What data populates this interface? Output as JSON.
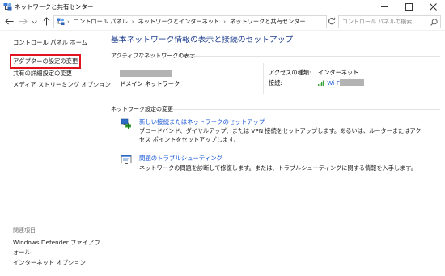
{
  "window": {
    "title": "ネットワークと共有センター",
    "controls": {
      "minimize": "minimize-icon",
      "maximize": "maximize-icon",
      "close": "close-icon"
    }
  },
  "address_bar": {
    "breadcrumbs": [
      "コントロール パネル",
      "ネットワークとインターネット",
      "ネットワークと共有センター"
    ],
    "separator": "›",
    "search_placeholder": "コントロール パネルの検索"
  },
  "sidebar": {
    "links": [
      {
        "label": "コントロール パネル ホーム",
        "highlighted": false
      },
      {
        "label": "アダプターの設定の変更",
        "highlighted": true
      },
      {
        "label": "共有の詳細設定の変更",
        "highlighted": false
      },
      {
        "label": "メディア ストリーミング オプション",
        "highlighted": false
      }
    ],
    "related_heading": "関連項目",
    "related_links": [
      {
        "label": "Windows Defender ファイアウォール"
      },
      {
        "label": "インターネット オプション"
      }
    ]
  },
  "main": {
    "title": "基本ネットワーク情報の表示と接続のセットアップ",
    "active_networks_heading": "アクティブなネットワークの表示",
    "network": {
      "type": "ドメイン ネットワーク",
      "access_type_label": "アクセスの種類:",
      "access_type_value": "インターネット",
      "connection_label": "接続:",
      "connection_value": "Wi-Fi"
    },
    "change_settings_heading": "ネットワーク設定の変更",
    "tasks": [
      {
        "icon": "new-connection-icon",
        "label": "新しい接続またはネットワークのセットアップ",
        "description": "ブロードバンド、ダイヤルアップ、または VPN 接続をセットアップします。あるいは、ルーターまたはアクセス ポイントをセットアップします。"
      },
      {
        "icon": "troubleshoot-icon",
        "label": "問題のトラブルシューティング",
        "description": "ネットワークの問題を診断して修復します。または、トラブルシューティングに関する情報を入手します。"
      }
    ]
  },
  "colors": {
    "title_blue": "#1e3d8f",
    "link_blue": "#1a5ad6",
    "highlight_red": "#e0131e",
    "redaction_gray": "#b3b3b3"
  }
}
